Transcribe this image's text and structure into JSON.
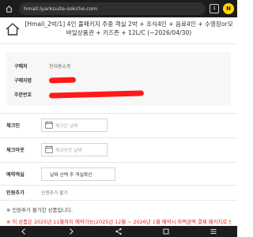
{
  "browser": {
    "url": "hmall.lyarksuite-sokcho.com",
    "tab_count": "1",
    "app_badge": "N"
  },
  "header": {
    "title": "[Hmall_2박/1] 4인 풀패키지 주중 객실 2박 + 조식4인 + 음료4인 + 수영장or모바일상품권 + 키즈존 + 12L/C (~2026/04/30)"
  },
  "buyer": {
    "store_label": "구매처",
    "store_value": "현대홈쇼핑",
    "name_label": "구매자명",
    "order_label": "주문번호"
  },
  "checkin": {
    "label": "체크인",
    "placeholder": "체크인 날짜"
  },
  "checkout": {
    "label": "체크아웃",
    "placeholder": "체크아웃 날짜"
  },
  "room": {
    "label": "예약객실",
    "selected": "날짜 선택 후 객실확인"
  },
  "guests": {
    "label": "인원추가",
    "value": "인원추가 불가"
  },
  "notes": {
    "note1": "※ 인원추가 불가한 상품입니다.",
    "note2": "※ 이 상품은 2025년 11월까지 예약가능(2025년 12월 ~ 2026년 1월 예약시 차액금액 결제 패키지로 변경)"
  },
  "colors": {
    "redact": "#ff1a1a",
    "accent_red": "#e2231a",
    "urlbar_bg": "#1c1c1c",
    "badge": "#ffd400"
  },
  "icons": [
    "home-icon",
    "calendar-icon",
    "back-icon",
    "forward-icon",
    "share-icon",
    "tabs-icon",
    "menu-icon"
  ]
}
